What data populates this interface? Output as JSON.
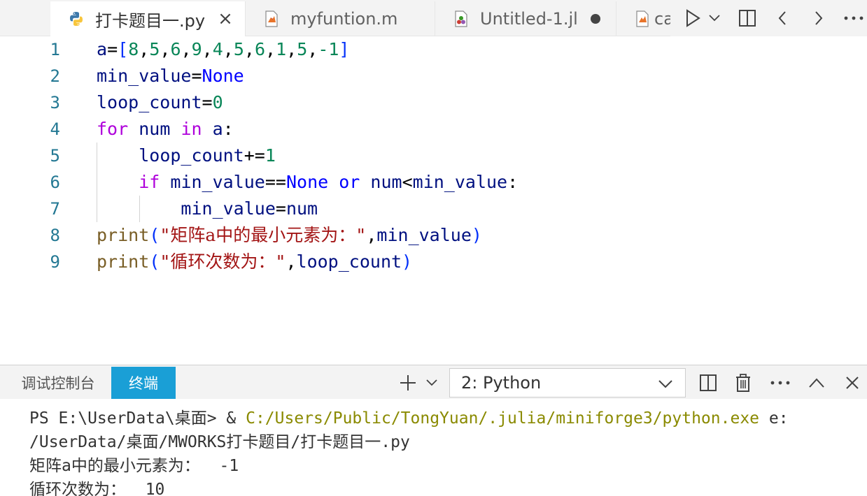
{
  "tabs": [
    {
      "label": "打卡题目一.py",
      "icon": "python-file-icon",
      "active": true,
      "action": "×"
    },
    {
      "label": "myfuntion.m",
      "icon": "matlab-file-icon",
      "active": false
    },
    {
      "label": "Untitled-1.jl",
      "icon": "julia-file-icon",
      "active": false,
      "dirty": true
    },
    {
      "label": "ca",
      "icon": "matlab-file-icon",
      "active": false
    }
  ],
  "editor": {
    "line_numbers": [
      "1",
      "2",
      "3",
      "4",
      "5",
      "6",
      "7",
      "8",
      "9"
    ],
    "lines": [
      [
        [
          "t-var",
          "a"
        ],
        [
          "t-op",
          "="
        ],
        [
          "t-br1",
          "["
        ],
        [
          "t-num",
          "8"
        ],
        [
          "t-op",
          ","
        ],
        [
          "t-num",
          "5"
        ],
        [
          "t-op",
          ","
        ],
        [
          "t-num",
          "6"
        ],
        [
          "t-op",
          ","
        ],
        [
          "t-num",
          "9"
        ],
        [
          "t-op",
          ","
        ],
        [
          "t-num",
          "4"
        ],
        [
          "t-op",
          ","
        ],
        [
          "t-num",
          "5"
        ],
        [
          "t-op",
          ","
        ],
        [
          "t-num",
          "6"
        ],
        [
          "t-op",
          ","
        ],
        [
          "t-num",
          "1"
        ],
        [
          "t-op",
          ","
        ],
        [
          "t-num",
          "5"
        ],
        [
          "t-op",
          ","
        ],
        [
          "t-num",
          "-1"
        ],
        [
          "t-br1",
          "]"
        ]
      ],
      [
        [
          "t-var",
          "min_value"
        ],
        [
          "t-op",
          "="
        ],
        [
          "t-kw",
          "None"
        ]
      ],
      [
        [
          "t-var",
          "loop_count"
        ],
        [
          "t-op",
          "="
        ],
        [
          "t-num",
          "0"
        ]
      ],
      [
        [
          "t-ctl",
          "for"
        ],
        [
          "t-op",
          " "
        ],
        [
          "t-var",
          "num"
        ],
        [
          "t-op",
          " "
        ],
        [
          "t-ctl",
          "in"
        ],
        [
          "t-op",
          " "
        ],
        [
          "t-var",
          "a"
        ],
        [
          "t-op",
          ":"
        ]
      ],
      [
        [
          "t-op",
          "    "
        ],
        [
          "t-var",
          "loop_count"
        ],
        [
          "t-op",
          "+="
        ],
        [
          "t-num",
          "1"
        ]
      ],
      [
        [
          "t-op",
          "    "
        ],
        [
          "t-ctl",
          "if"
        ],
        [
          "t-op",
          " "
        ],
        [
          "t-var",
          "min_value"
        ],
        [
          "t-op",
          "=="
        ],
        [
          "t-kw",
          "None"
        ],
        [
          "t-op",
          " "
        ],
        [
          "t-kw",
          "or"
        ],
        [
          "t-op",
          " "
        ],
        [
          "t-var",
          "num"
        ],
        [
          "t-op",
          "<"
        ],
        [
          "t-var",
          "min_value"
        ],
        [
          "t-op",
          ":"
        ]
      ],
      [
        [
          "t-op",
          "        "
        ],
        [
          "t-var",
          "min_value"
        ],
        [
          "t-op",
          "="
        ],
        [
          "t-var",
          "num"
        ]
      ],
      [
        [
          "t-fn",
          "print"
        ],
        [
          "t-br1",
          "("
        ],
        [
          "t-str",
          "\""
        ],
        [
          "t-str t-cjk",
          "矩阵a中的最小元素为："
        ],
        [
          "t-str",
          "\""
        ],
        [
          "t-op",
          ","
        ],
        [
          "t-var",
          "min_value"
        ],
        [
          "t-br1",
          ")"
        ]
      ],
      [
        [
          "t-fn",
          "print"
        ],
        [
          "t-br1",
          "("
        ],
        [
          "t-str",
          "\""
        ],
        [
          "t-str t-cjk",
          "循环次数为："
        ],
        [
          "t-str",
          "\""
        ],
        [
          "t-op",
          ","
        ],
        [
          "t-var",
          "loop_count"
        ],
        [
          "t-br1",
          ")"
        ]
      ]
    ]
  },
  "panel": {
    "tabs": [
      {
        "label": "调试控制台",
        "active": false
      },
      {
        "label": "终端",
        "active": true
      }
    ],
    "terminal_select": "2: Python",
    "terminal": {
      "line1_prompt": "PS E:\\UserData\\桌面> ",
      "line1_amp": "& ",
      "line1_path": "C:/Users/Public/TongYuan/.julia/miniforge3/python.exe",
      "line1_arg": " e:",
      "line2": "/UserData/桌面/MWORKS打卡题目/打卡题目一.py",
      "line3": "矩阵a中的最小元素为：  -1",
      "line4": "循环次数为：  10"
    }
  },
  "colors": {
    "active_panel_tab": "#1a9fd6",
    "line_number": "#237893",
    "keyword": "#0000ff",
    "control_keyword": "#af00db",
    "number": "#098658",
    "string": "#a31515",
    "function": "#795e26",
    "variable": "#001080"
  }
}
